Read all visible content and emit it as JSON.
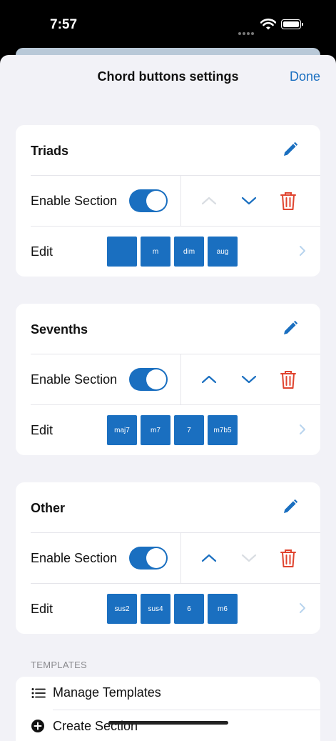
{
  "status": {
    "time": "7:57"
  },
  "nav": {
    "title": "Chord buttons settings",
    "done_label": "Done"
  },
  "accent_color": "#1a6fc0",
  "delete_color": "#e0442f",
  "sections": [
    {
      "title": "Triads",
      "enable_label": "Enable Section",
      "enabled": true,
      "up_enabled": false,
      "down_enabled": true,
      "edit_label": "Edit",
      "chips": [
        "",
        "m",
        "dim",
        "aug"
      ]
    },
    {
      "title": "Sevenths",
      "enable_label": "Enable Section",
      "enabled": true,
      "up_enabled": true,
      "down_enabled": true,
      "edit_label": "Edit",
      "chips": [
        "maj7",
        "m7",
        "7",
        "m7b5"
      ]
    },
    {
      "title": "Other",
      "enable_label": "Enable Section",
      "enabled": true,
      "up_enabled": true,
      "down_enabled": false,
      "edit_label": "Edit",
      "chips": [
        "sus2",
        "sus4",
        "6",
        "m6"
      ]
    }
  ],
  "templates": {
    "header": "TEMPLATES",
    "items": [
      {
        "label": "Manage Templates",
        "icon": "list-icon"
      },
      {
        "label": "Create Section",
        "icon": "plus-circle-icon"
      }
    ]
  }
}
